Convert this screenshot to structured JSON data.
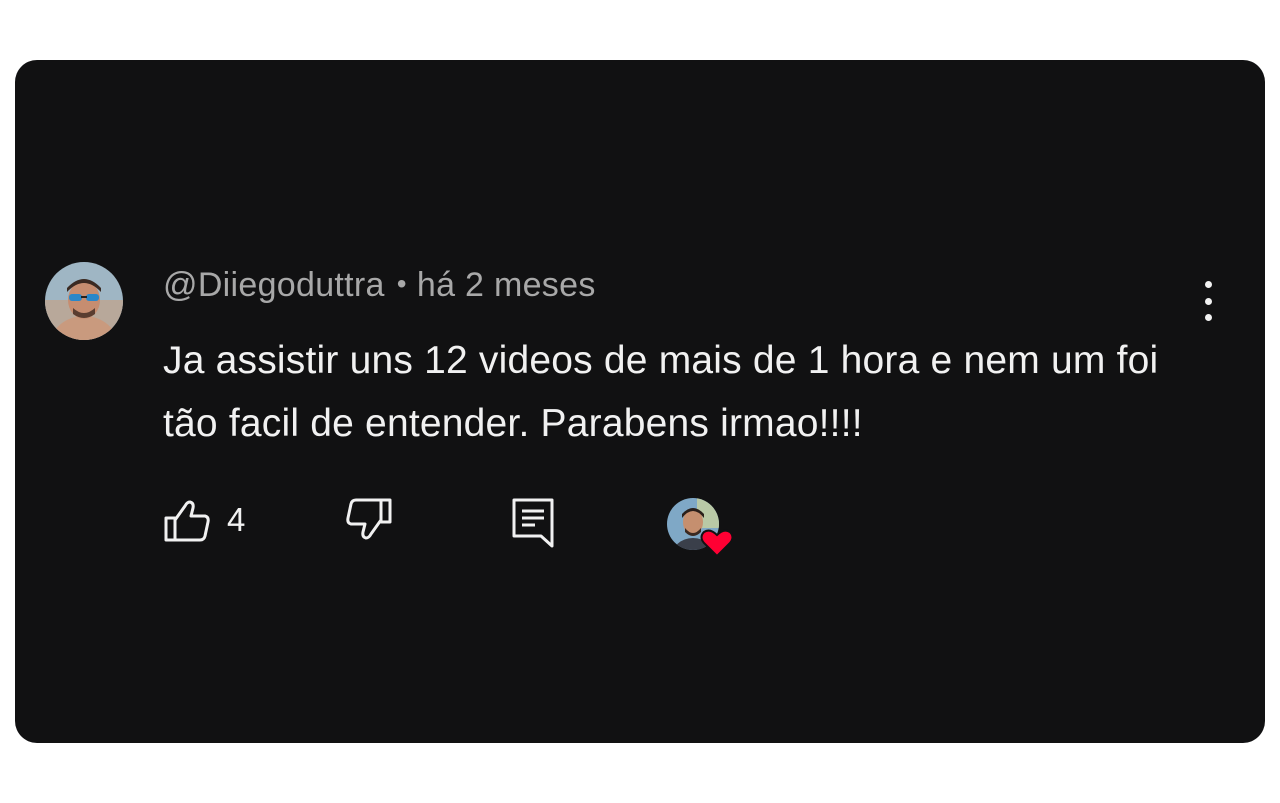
{
  "comment": {
    "author": "@Diiegoduttra",
    "separator": "•",
    "time": "há 2 meses",
    "text": "Ja assistir uns 12 videos de mais de 1 hora e nem um foi tão facil de entender. Parabens irmao!!!!",
    "like_count": "4"
  },
  "icons": {
    "menu": "more-vertical-icon",
    "like": "thumbs-up-icon",
    "dislike": "thumbs-down-icon",
    "reply": "reply-comment-icon",
    "heart": "heart-icon"
  },
  "colors": {
    "background": "#111112",
    "text": "#f1f1f1",
    "meta": "#a8a8a8",
    "heart": "#ff0033"
  }
}
